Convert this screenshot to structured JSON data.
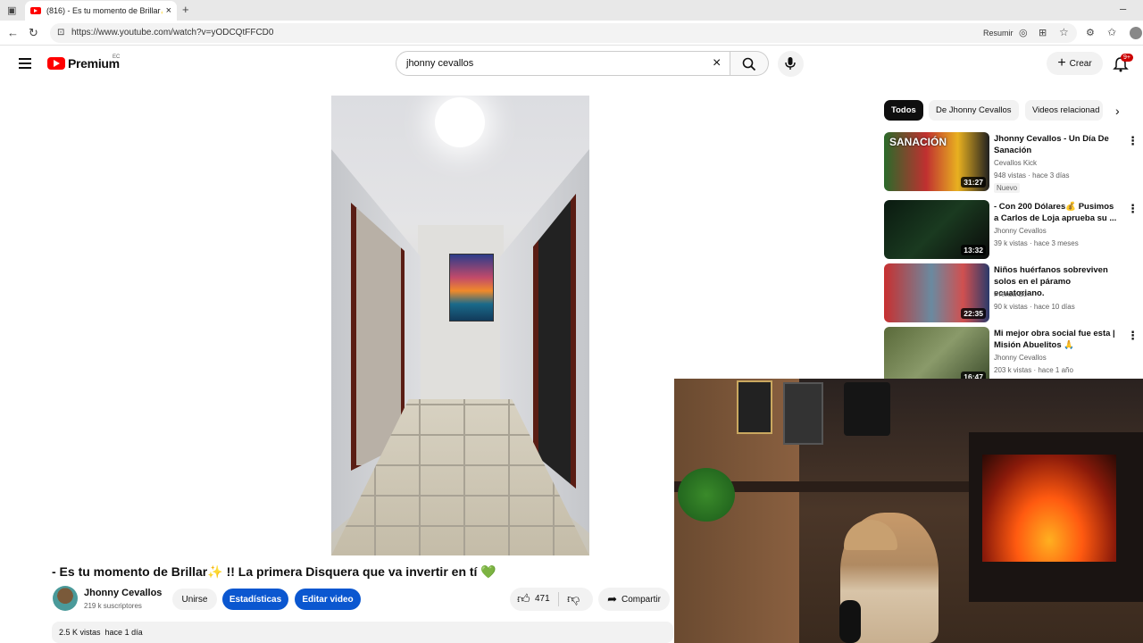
{
  "browser": {
    "tab_title": "(816) - Es tu momento de Brillar✨",
    "url": "https://www.youtube.com/watch?v=yODCQtFFCD0",
    "resumir": "Resumir"
  },
  "header": {
    "logo": "Premium",
    "country": "EC",
    "search_value": "jhonny cevallos",
    "create_label": "Crear",
    "notif_count": "9+"
  },
  "video": {
    "title": "- Es tu momento de Brillar✨ !! La primera Disquera que va invertir en tí 💚",
    "channel": "Jhonny Cevallos",
    "subscribers": "219 k suscriptores",
    "join": "Unirse",
    "stats": "Estadísticas",
    "edit": "Editar video",
    "likes": "471",
    "share": "Compartir",
    "views": "2.5 K vistas",
    "date": "hace 1 día"
  },
  "sidebar": {
    "chips": [
      "Todos",
      "De Jhonny Cevallos",
      "Videos relacionad"
    ],
    "videos": [
      {
        "title": "Jhonny Cevallos - Un Día De Sanación",
        "channel": "Cevallos Kick",
        "meta": "948 vistas · hace 3 días",
        "badge": "Nuevo",
        "duration": "31:27",
        "thumb_text": "SANACIÓN"
      },
      {
        "title": "- Con 200 Dólares💰 Pusimos a Carlos de Loja aprueba su ...",
        "channel": "Jhonny Cevallos",
        "meta": "39 k vistas · hace 3 meses",
        "badge": "",
        "duration": "13:32",
        "thumb_text": ""
      },
      {
        "title": "Niños huérfanos sobreviven solos en el páramo ecuatoriano.",
        "channel": "Prensa Ec",
        "meta": "90 k vistas · hace 10 días",
        "badge": "",
        "duration": "22:35",
        "thumb_text": ""
      },
      {
        "title": "Mi mejor obra social fue esta | Misión Abuelitos 🙏",
        "channel": "Jhonny Cevallos",
        "meta": "203 k vistas · hace 1 año",
        "badge": "",
        "duration": "16:47",
        "thumb_text": ""
      }
    ]
  },
  "colors": {
    "accent": "#0b57d0",
    "brand": "#ff0000"
  }
}
